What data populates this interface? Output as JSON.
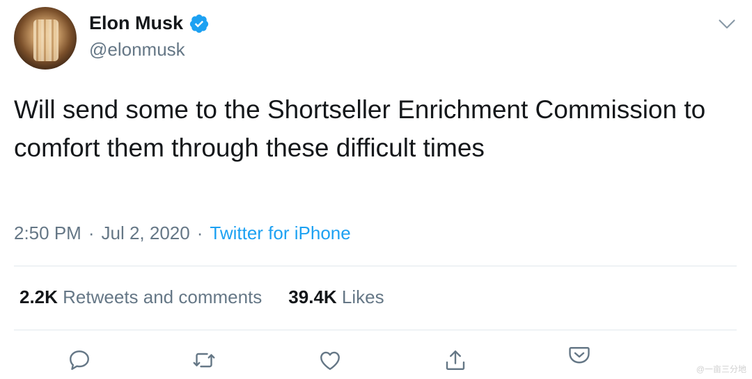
{
  "author": {
    "name": "Elon Musk",
    "handle": "@elonmusk",
    "verified": true
  },
  "tweet": {
    "text": "Will send some to the Shortseller Enrichment Commission to comfort them through these difficult times",
    "time": "2:50 PM",
    "date": "Jul 2, 2020",
    "source": "Twitter for iPhone",
    "separator": "·"
  },
  "stats": {
    "retweets_count": "2.2K",
    "retweets_label": "Retweets and comments",
    "likes_count": "39.4K",
    "likes_label": "Likes"
  },
  "icons": {
    "reply": "reply-icon",
    "retweet": "retweet-icon",
    "like": "like-icon",
    "share": "share-icon",
    "more": "chevron-down-icon",
    "pocket": "pocket-icon"
  },
  "colors": {
    "accent": "#1da1f2",
    "secondary_text": "#657786",
    "primary_text": "#14171a"
  },
  "watermark": "@一亩三分地"
}
